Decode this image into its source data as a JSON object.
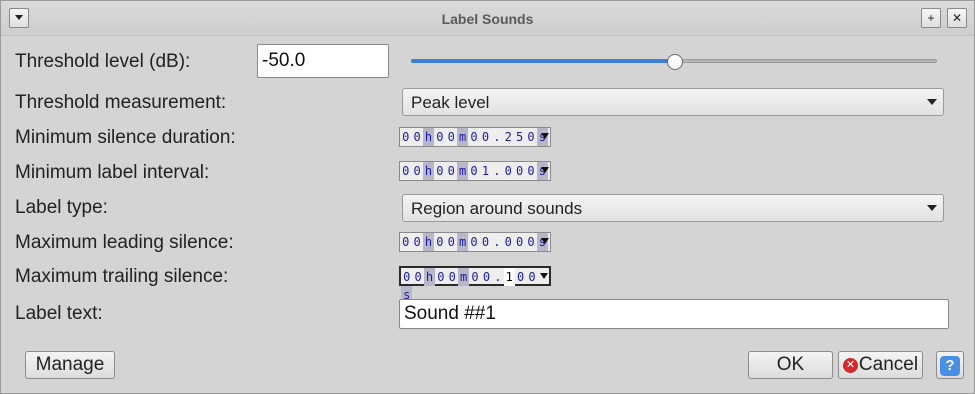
{
  "window": {
    "title": "Label Sounds",
    "menu_icon": "chevron-down-icon",
    "pin_glyph": "+",
    "close_glyph": "✕"
  },
  "threshold_level": {
    "label": "Threshold level (dB):",
    "value": "-50.0",
    "slider_fraction": 0.5
  },
  "threshold_measurement": {
    "label": "Threshold measurement:",
    "selected": "Peak level"
  },
  "min_silence_duration": {
    "label": "Minimum silence duration:",
    "digits": [
      "0",
      "0",
      "h",
      "0",
      "0",
      "m",
      "0",
      "0",
      ".",
      "2",
      "5",
      "0",
      "s"
    ]
  },
  "min_label_interval": {
    "label": "Minimum label interval:",
    "digits": [
      "0",
      "0",
      "h",
      "0",
      "0",
      "m",
      "0",
      "1",
      ".",
      "0",
      "0",
      "0",
      "s"
    ]
  },
  "label_type": {
    "label": "Label type:",
    "selected": "Region around sounds"
  },
  "max_leading_silence": {
    "label": "Maximum leading silence:",
    "digits": [
      "0",
      "0",
      "h",
      "0",
      "0",
      "m",
      "0",
      "0",
      ".",
      "0",
      "0",
      "0",
      "s"
    ]
  },
  "max_trailing_silence": {
    "label": "Maximum trailing silence:",
    "digits": [
      "0",
      "0",
      "h",
      "0",
      "0",
      "m",
      "0",
      "0",
      ".",
      "1",
      "0",
      "0",
      "s"
    ]
  },
  "label_text": {
    "label": "Label text:",
    "value": "Sound ##1"
  },
  "buttons": {
    "manage": "Manage",
    "ok": "OK",
    "cancel": "Cancel",
    "help": "?"
  },
  "colors": {
    "accent": "#3d7fd6",
    "background": "#d4d4d4",
    "digit": "#1c1ca0"
  }
}
